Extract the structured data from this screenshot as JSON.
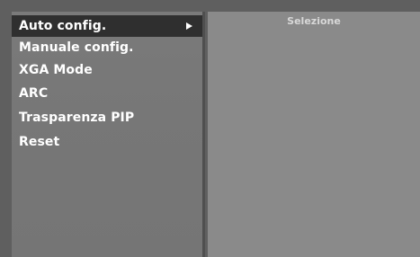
{
  "menu": {
    "items": [
      {
        "label": "Auto config.",
        "selected": true,
        "has_submenu": true
      },
      {
        "label": "Manuale config.",
        "selected": false,
        "has_submenu": false
      },
      {
        "label": "XGA Mode",
        "selected": false,
        "has_submenu": false
      },
      {
        "label": "ARC",
        "selected": false,
        "has_submenu": false
      },
      {
        "label": "Trasparenza PIP",
        "selected": false,
        "has_submenu": false
      },
      {
        "label": "Reset",
        "selected": false,
        "has_submenu": false
      }
    ]
  },
  "submenu": {
    "title": "Selezione"
  },
  "colors": {
    "frame": "#5f5f5f",
    "left_panel": "#777777",
    "right_panel": "#8a8a8a",
    "selected_bar": "#2f2f2f",
    "text": "#ffffff"
  }
}
